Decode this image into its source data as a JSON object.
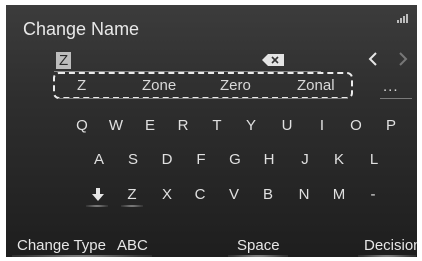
{
  "header": {
    "title": "Change Name"
  },
  "input": {
    "value": "Z"
  },
  "suggestions": [
    "Z",
    "Zone",
    "Zero",
    "Zonal"
  ],
  "more_label": "...",
  "keyboard": {
    "row1": [
      "Q",
      "W",
      "E",
      "R",
      "T",
      "Y",
      "U",
      "I",
      "O",
      "P"
    ],
    "row2": [
      "A",
      "S",
      "D",
      "F",
      "G",
      "H",
      "J",
      "K",
      "L"
    ],
    "row3": [
      "Z",
      "X",
      "C",
      "V",
      "B",
      "N",
      "M",
      "-"
    ]
  },
  "bottom_bar": {
    "change_type_label": "Change Type",
    "mode_label": "ABC",
    "space_label": "Space",
    "decision_label": "Decision"
  },
  "icons": {
    "backspace": "backspace-icon",
    "prev": "chevron-left-icon",
    "next": "chevron-right-icon",
    "shift": "shift-down-arrow-icon",
    "signal": "signal-strength-icon"
  }
}
